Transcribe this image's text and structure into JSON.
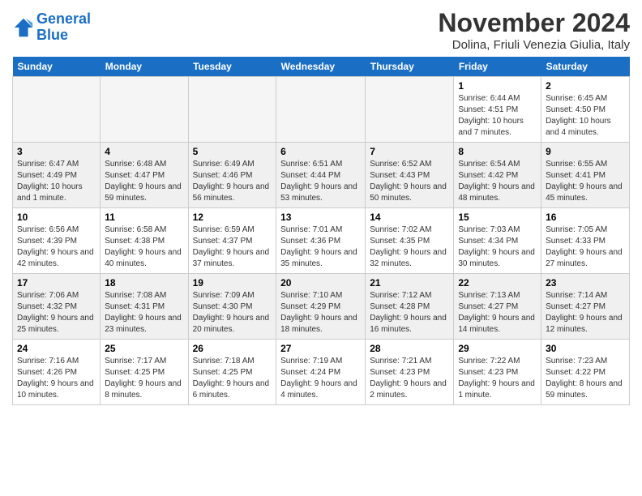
{
  "header": {
    "logo_general": "General",
    "logo_blue": "Blue",
    "month_title": "November 2024",
    "location": "Dolina, Friuli Venezia Giulia, Italy"
  },
  "days_of_week": [
    "Sunday",
    "Monday",
    "Tuesday",
    "Wednesday",
    "Thursday",
    "Friday",
    "Saturday"
  ],
  "weeks": [
    [
      {
        "day": "",
        "info": ""
      },
      {
        "day": "",
        "info": ""
      },
      {
        "day": "",
        "info": ""
      },
      {
        "day": "",
        "info": ""
      },
      {
        "day": "",
        "info": ""
      },
      {
        "day": "1",
        "info": "Sunrise: 6:44 AM\nSunset: 4:51 PM\nDaylight: 10 hours and 7 minutes."
      },
      {
        "day": "2",
        "info": "Sunrise: 6:45 AM\nSunset: 4:50 PM\nDaylight: 10 hours and 4 minutes."
      }
    ],
    [
      {
        "day": "3",
        "info": "Sunrise: 6:47 AM\nSunset: 4:49 PM\nDaylight: 10 hours and 1 minute."
      },
      {
        "day": "4",
        "info": "Sunrise: 6:48 AM\nSunset: 4:47 PM\nDaylight: 9 hours and 59 minutes."
      },
      {
        "day": "5",
        "info": "Sunrise: 6:49 AM\nSunset: 4:46 PM\nDaylight: 9 hours and 56 minutes."
      },
      {
        "day": "6",
        "info": "Sunrise: 6:51 AM\nSunset: 4:44 PM\nDaylight: 9 hours and 53 minutes."
      },
      {
        "day": "7",
        "info": "Sunrise: 6:52 AM\nSunset: 4:43 PM\nDaylight: 9 hours and 50 minutes."
      },
      {
        "day": "8",
        "info": "Sunrise: 6:54 AM\nSunset: 4:42 PM\nDaylight: 9 hours and 48 minutes."
      },
      {
        "day": "9",
        "info": "Sunrise: 6:55 AM\nSunset: 4:41 PM\nDaylight: 9 hours and 45 minutes."
      }
    ],
    [
      {
        "day": "10",
        "info": "Sunrise: 6:56 AM\nSunset: 4:39 PM\nDaylight: 9 hours and 42 minutes."
      },
      {
        "day": "11",
        "info": "Sunrise: 6:58 AM\nSunset: 4:38 PM\nDaylight: 9 hours and 40 minutes."
      },
      {
        "day": "12",
        "info": "Sunrise: 6:59 AM\nSunset: 4:37 PM\nDaylight: 9 hours and 37 minutes."
      },
      {
        "day": "13",
        "info": "Sunrise: 7:01 AM\nSunset: 4:36 PM\nDaylight: 9 hours and 35 minutes."
      },
      {
        "day": "14",
        "info": "Sunrise: 7:02 AM\nSunset: 4:35 PM\nDaylight: 9 hours and 32 minutes."
      },
      {
        "day": "15",
        "info": "Sunrise: 7:03 AM\nSunset: 4:34 PM\nDaylight: 9 hours and 30 minutes."
      },
      {
        "day": "16",
        "info": "Sunrise: 7:05 AM\nSunset: 4:33 PM\nDaylight: 9 hours and 27 minutes."
      }
    ],
    [
      {
        "day": "17",
        "info": "Sunrise: 7:06 AM\nSunset: 4:32 PM\nDaylight: 9 hours and 25 minutes."
      },
      {
        "day": "18",
        "info": "Sunrise: 7:08 AM\nSunset: 4:31 PM\nDaylight: 9 hours and 23 minutes."
      },
      {
        "day": "19",
        "info": "Sunrise: 7:09 AM\nSunset: 4:30 PM\nDaylight: 9 hours and 20 minutes."
      },
      {
        "day": "20",
        "info": "Sunrise: 7:10 AM\nSunset: 4:29 PM\nDaylight: 9 hours and 18 minutes."
      },
      {
        "day": "21",
        "info": "Sunrise: 7:12 AM\nSunset: 4:28 PM\nDaylight: 9 hours and 16 minutes."
      },
      {
        "day": "22",
        "info": "Sunrise: 7:13 AM\nSunset: 4:27 PM\nDaylight: 9 hours and 14 minutes."
      },
      {
        "day": "23",
        "info": "Sunrise: 7:14 AM\nSunset: 4:27 PM\nDaylight: 9 hours and 12 minutes."
      }
    ],
    [
      {
        "day": "24",
        "info": "Sunrise: 7:16 AM\nSunset: 4:26 PM\nDaylight: 9 hours and 10 minutes."
      },
      {
        "day": "25",
        "info": "Sunrise: 7:17 AM\nSunset: 4:25 PM\nDaylight: 9 hours and 8 minutes."
      },
      {
        "day": "26",
        "info": "Sunrise: 7:18 AM\nSunset: 4:25 PM\nDaylight: 9 hours and 6 minutes."
      },
      {
        "day": "27",
        "info": "Sunrise: 7:19 AM\nSunset: 4:24 PM\nDaylight: 9 hours and 4 minutes."
      },
      {
        "day": "28",
        "info": "Sunrise: 7:21 AM\nSunset: 4:23 PM\nDaylight: 9 hours and 2 minutes."
      },
      {
        "day": "29",
        "info": "Sunrise: 7:22 AM\nSunset: 4:23 PM\nDaylight: 9 hours and 1 minute."
      },
      {
        "day": "30",
        "info": "Sunrise: 7:23 AM\nSunset: 4:22 PM\nDaylight: 8 hours and 59 minutes."
      }
    ]
  ]
}
